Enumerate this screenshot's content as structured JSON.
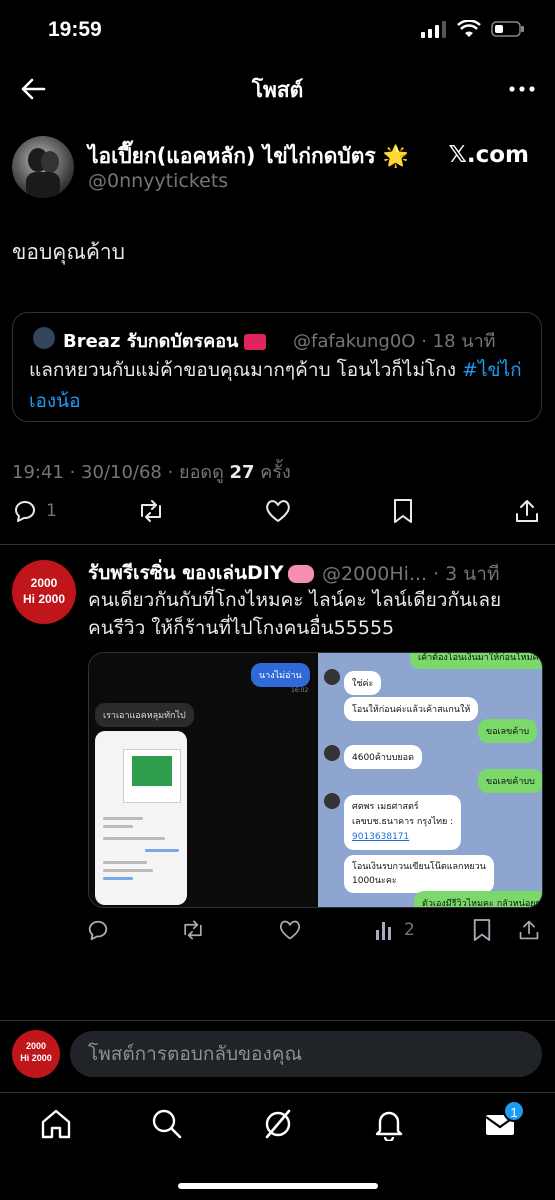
{
  "status_bar": {
    "time": "19:59"
  },
  "header": {
    "title": "โพสต์"
  },
  "post": {
    "author_name": "ไอเปี๊ยก(แอคหลัก) ไข่ไก่กดบัตร 🌟",
    "author_handle": "@0nnyytickets",
    "watermark": "𝕏.com",
    "text": "ขอบคุณค้าบ",
    "quote": {
      "author_name": "Breaz รับกดบัตรคอน",
      "author_handle": "@fafakung0O · 18 นาที",
      "text": "แลกหยวนกับแม่ค้าขอบคุณมากๆค้าบ โอนไวก็ไม่โกง ",
      "hashtag": "#ไข่ไก่เองน้อ"
    },
    "timestamp": "19:41 · 30/10/68 · ยอดดู ",
    "views": "27",
    "views_suffix": " ครั้ง",
    "reply_count": "1"
  },
  "reply": {
    "avatar_line1": "2000",
    "avatar_line2": "Hi 2000",
    "author_name": "รับพรีเรซิ่น ของเล่นDIY",
    "author_handle": "@2000Hi... · 3 นาที",
    "text_line1": "คนเดียวกันกับที่โกงไหมคะ ไลน์คะ ไลน์เดียวกันเลย",
    "text_line2": "คนรีวิว ให้ก็ร้านที่ไปโกงคนอื่น55555",
    "views": "2",
    "media": {
      "left": {
        "bubble1": "นางไม่อ่าน",
        "time1": "16:02",
        "bubble2": "เราเอาแอคหลุมทักไป"
      },
      "right": {
        "top": "เค้าต้องโอนเงินมาให้ก่อนไหมคะ",
        "b1": "ใช่ค่ะ",
        "b2": "โอนให้ก่อนค่ะแล้วเค้าสแกนให้",
        "g1": "ขอเลขค้าบ",
        "b3": "4600ค้าบบยอด",
        "g2": "ขอเลขค้าบบ",
        "b4_l1": "ศตพร  เมธศาสตร์",
        "b4_l2": "เลขบช.ธนาคาร กรุงไทย :",
        "b4_l3": "9013638171",
        "b5_l1": "โอนเงินรบกวนเขียนโน๊ตแลกหยวน",
        "b5_l2": "1000นะคะ",
        "g3": "ตัวเองมีรีวิวไหมคะ กลัวหน่อยๆ"
      }
    }
  },
  "composer": {
    "placeholder": "โพสต์การตอบกลับของคุณ"
  },
  "tabbar": {
    "badge": "1"
  }
}
